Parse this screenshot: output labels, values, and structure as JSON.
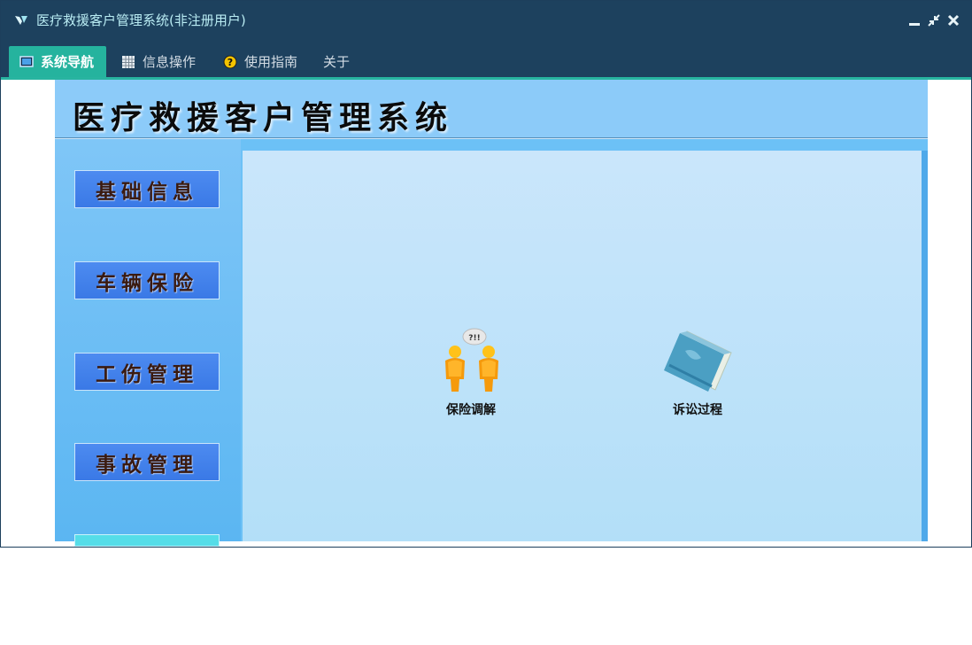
{
  "window": {
    "title": "医疗救援客户管理系统(非注册用户)"
  },
  "menu": {
    "tabs": [
      {
        "label": "系统导航",
        "icon": "monitor-icon",
        "active": true
      },
      {
        "label": "信息操作",
        "icon": "grid-icon",
        "active": false
      },
      {
        "label": "使用指南",
        "icon": "help-icon",
        "active": false
      },
      {
        "label": "关于",
        "icon": "",
        "active": false
      }
    ]
  },
  "header": {
    "title": "医疗救援客户管理系统"
  },
  "sidebar": {
    "items": [
      {
        "label": "基础信息"
      },
      {
        "label": "车辆保险"
      },
      {
        "label": "工伤管理"
      },
      {
        "label": "事故管理"
      }
    ]
  },
  "main": {
    "functions": [
      {
        "label": "保险调解",
        "icon": "people-talk-icon"
      },
      {
        "label": "诉讼过程",
        "icon": "book-icon"
      }
    ]
  },
  "colors": {
    "titlebar": "#1d415e",
    "active_tab": "#25b39e",
    "sidebar_button": "#3a79e6",
    "panel": "#6cc1f6"
  }
}
